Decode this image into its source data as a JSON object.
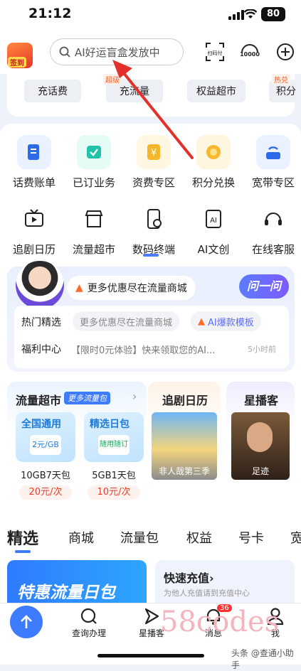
{
  "status_bar": {
    "time": "21:12",
    "battery": "80"
  },
  "header": {
    "sign_in_badge": "签到",
    "search_placeholder": "AI好运盲盒发放中",
    "scan_label": "扫码付",
    "service_label": "10000"
  },
  "quick_tags": [
    {
      "label": "充话费",
      "badge": ""
    },
    {
      "label": "充流量",
      "badge": "超级"
    },
    {
      "label": "权益超市",
      "badge": ""
    },
    {
      "label": "积分",
      "badge": "热兑"
    }
  ],
  "grid_row1": [
    {
      "label": "话费账单",
      "icon": "bill-icon"
    },
    {
      "label": "已订业务",
      "icon": "subscription-icon"
    },
    {
      "label": "资费专区",
      "icon": "tariff-icon"
    },
    {
      "label": "积分兑换",
      "icon": "points-icon"
    },
    {
      "label": "宽带专区",
      "icon": "broadband-icon"
    }
  ],
  "grid_row2": [
    {
      "label": "追剧日历",
      "icon": "tv-icon"
    },
    {
      "label": "流量超市",
      "icon": "store-icon"
    },
    {
      "label": "数码终端",
      "icon": "phone-icon"
    },
    {
      "label": "AI文创",
      "icon": "ai-icon"
    },
    {
      "label": "在线客服",
      "icon": "headset-icon"
    }
  ],
  "ai_panel": {
    "bubble_text": "更多优惠尽在流量商城",
    "ask_button": "问一问",
    "hot_label": "热门精选",
    "hot_pills": [
      "更多优惠尽在流量商城",
      "AI爆款模板"
    ],
    "welfare_label": "福利中心",
    "welfare_text": "【限时0元体验】快来领取您的AI...",
    "welfare_time": "5小时前"
  },
  "traffic_store": {
    "title": "流量超市",
    "badge": "更多流量包",
    "products": [
      {
        "tag": "全国通用",
        "chip": "2元/GB",
        "name": "10GB7天包",
        "price": "20元/次"
      },
      {
        "tag": "精选日包",
        "chip": "随用随订",
        "name": "5GB1天包",
        "price": "10元/次"
      }
    ]
  },
  "drama_calendar": {
    "title": "追剧日历",
    "caption": "非人哉第三季"
  },
  "star_broadcast": {
    "title": "星播客",
    "caption": "足迹"
  },
  "content_tabs": [
    "精选",
    "商城",
    "流量包",
    "权益",
    "号卡",
    "宽"
  ],
  "promo": {
    "left_text": "特惠流量日包",
    "right_title": "快速充值",
    "right_arrow": "›",
    "right_sub": "为他人充值请到充值中心"
  },
  "bottom_nav": [
    {
      "label": "查询办理",
      "icon": "query-icon",
      "badge": ""
    },
    {
      "label": "星播客",
      "icon": "play-icon",
      "badge": ""
    },
    {
      "label": "消息",
      "icon": "bell-icon",
      "badge": "36"
    },
    {
      "label": "我",
      "icon": "user-icon",
      "badge": ""
    }
  ],
  "watermark": {
    "large": "58codes",
    "small": "头条 @查通小助手"
  },
  "colors": {
    "accent": "#3d7bff",
    "annotation_arrow": "#e3302a"
  }
}
